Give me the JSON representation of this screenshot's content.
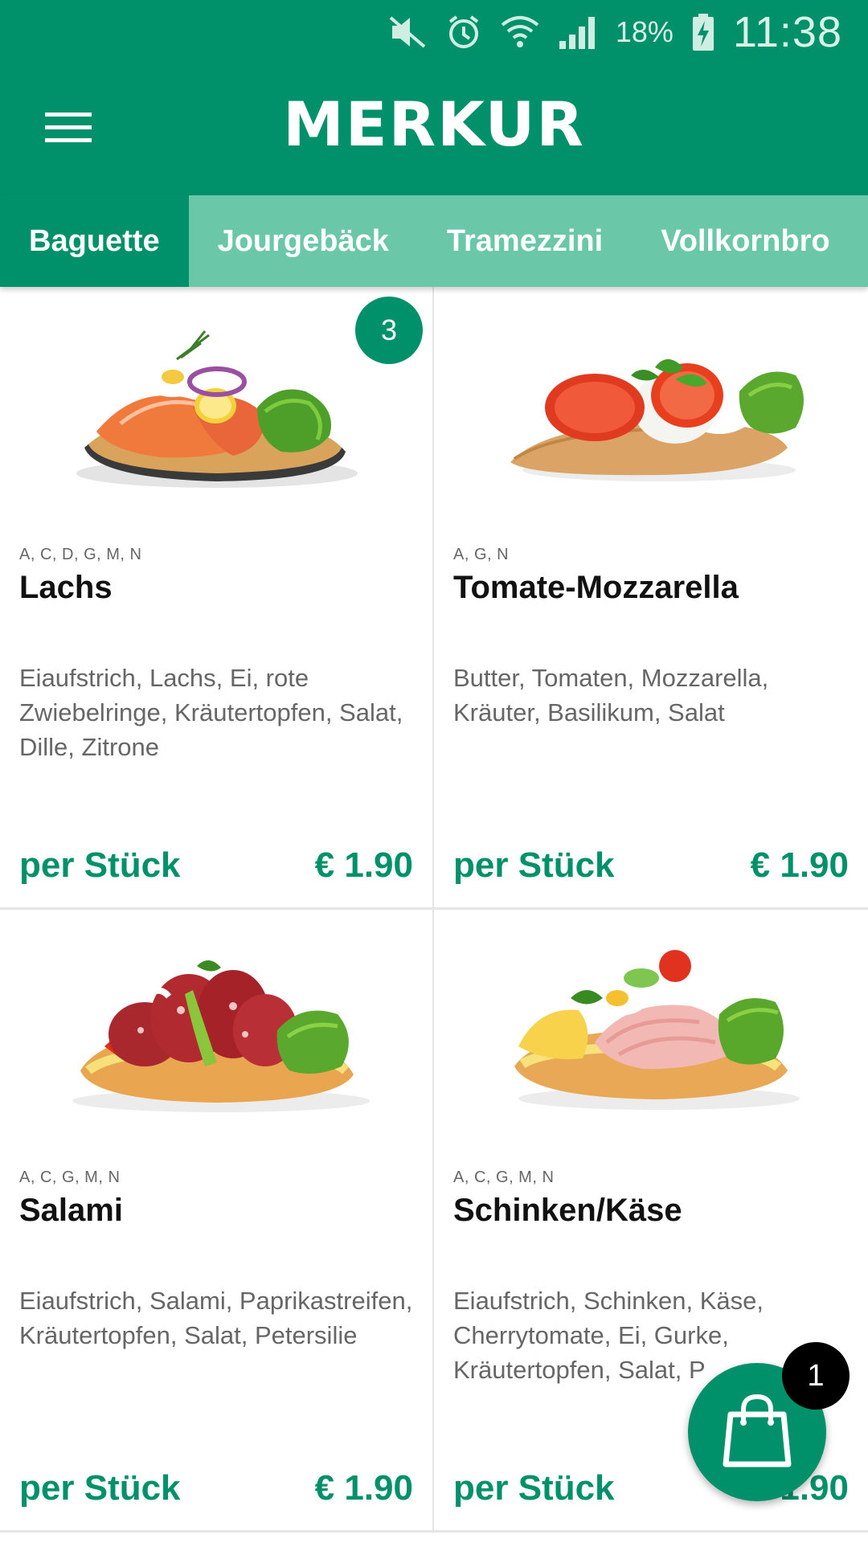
{
  "status_bar": {
    "icons": [
      "mute-icon",
      "alarm-icon",
      "wifi-icon",
      "signal-icon",
      "battery-charging-icon"
    ],
    "battery": "18%",
    "time": "11:38"
  },
  "app_bar": {
    "brand": "MERKUR",
    "menu_icon": "hamburger-menu-icon"
  },
  "tabs": [
    {
      "label": "Baguette",
      "active": true
    },
    {
      "label": "Jourgebäck",
      "active": false
    },
    {
      "label": "Tramezzini",
      "active": false
    },
    {
      "label": "Vollkornbro",
      "active": false
    }
  ],
  "products": [
    {
      "allergens": "A, C, D, G, M, N",
      "name": "Lachs",
      "description": "Eiaufstrich, Lachs, Ei, rote Zwiebelringe, Kräutertopfen, Salat, Dille, Zitrone",
      "unit": "per Stück",
      "price": "€ 1.90",
      "quantity_badge": "3"
    },
    {
      "allergens": "A, G, N",
      "name": "Tomate-Mozzarella",
      "description": "Butter, Tomaten, Mozzarella, Kräuter, Basilikum, Salat",
      "unit": "per Stück",
      "price": "€ 1.90"
    },
    {
      "allergens": "A, C, G, M, N",
      "name": "Salami",
      "description": "Eiaufstrich, Salami, Paprikastreifen, Kräutertopfen, Salat, Petersilie",
      "unit": "per Stück",
      "price": "€ 1.90"
    },
    {
      "allergens": "A, C, G, M, N",
      "name": "Schinken/Käse",
      "description": "Eiaufstrich, Schinken, Käse, Cherrytomate, Ei, Gurke, Kräutertopfen, Salat, P",
      "unit": "per Stück",
      "price": "€ 1.90"
    }
  ],
  "cart": {
    "icon": "shopping-bag-icon",
    "count": "1"
  },
  "colors": {
    "primary": "#00916a",
    "tab_bar": "#6ac7a8",
    "text_muted": "#666666"
  }
}
